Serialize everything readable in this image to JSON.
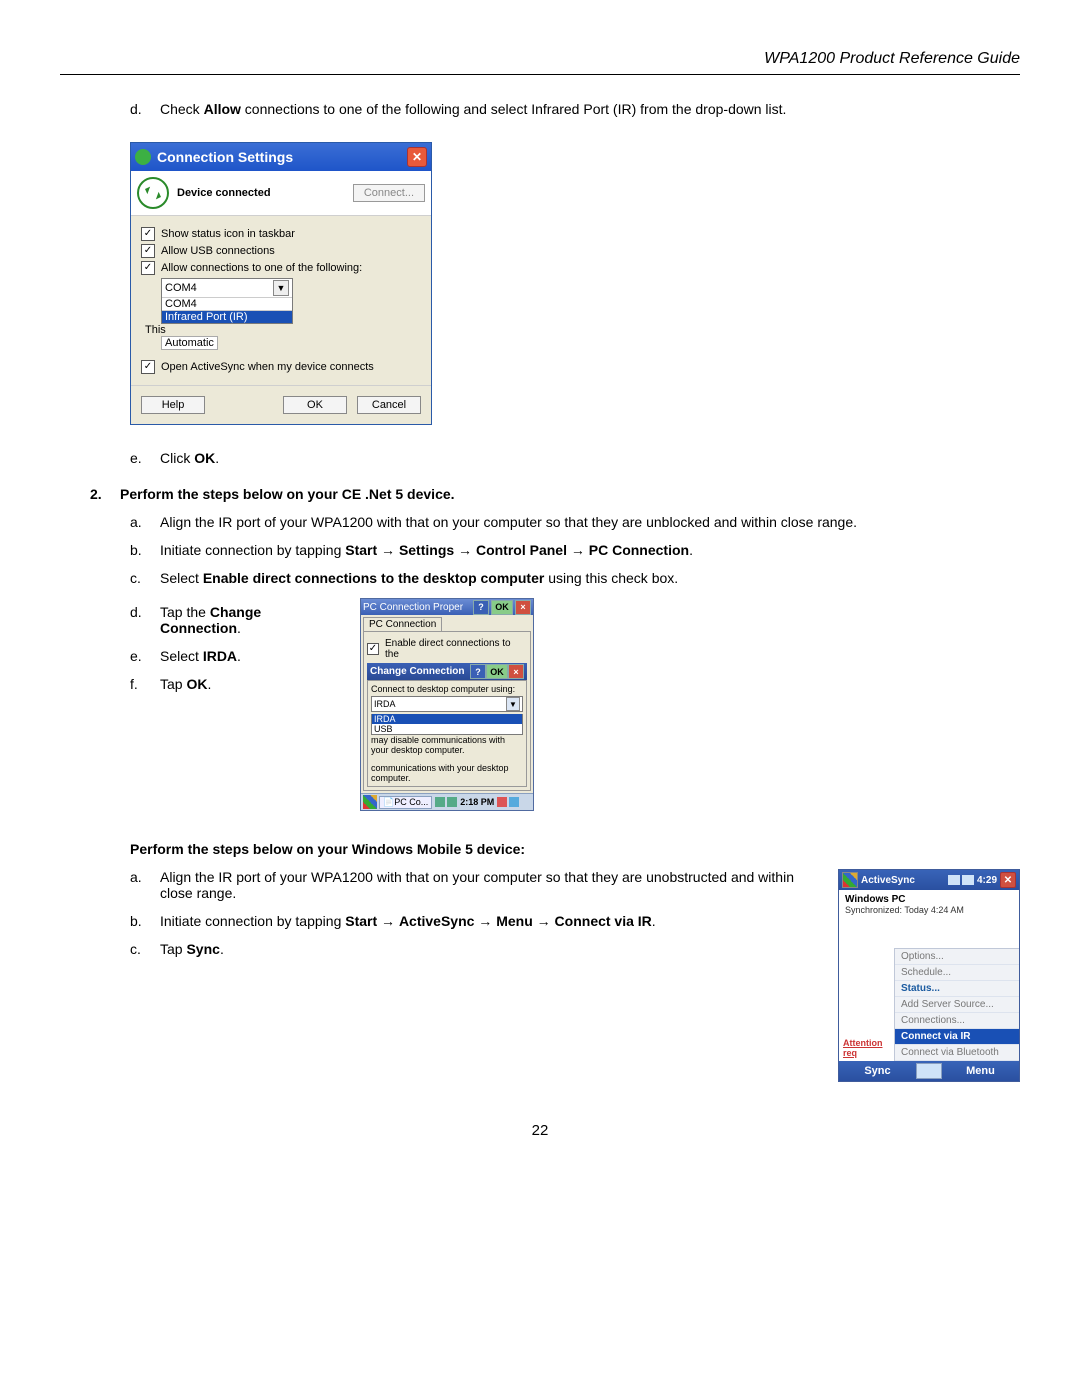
{
  "header": {
    "title": "WPA1200 Product Reference Guide"
  },
  "pageNumber": "22",
  "step_d": {
    "marker": "d.",
    "text_pre": "Check ",
    "text_bold": "Allow",
    "text_post": " connections to one of the following and select Infrared Port (IR) from the drop-down list."
  },
  "win1": {
    "title": "Connection Settings",
    "status": "Device connected",
    "connect_btn": "Connect...",
    "chk1": "Show status icon in taskbar",
    "chk2": "Allow USB connections",
    "chk3": "Allow connections to one of the following:",
    "combo_selected": "COM4",
    "combo_opt1": "COM4",
    "combo_opt2": "Infrared Port (IR)",
    "side_this": "This",
    "side_auto": "Automatic",
    "chk4": "Open ActiveSync when my device connects",
    "btn_help": "Help",
    "btn_ok": "OK",
    "btn_cancel": "Cancel"
  },
  "step_e": {
    "marker": "e.",
    "pre": "Click ",
    "bold": "OK",
    "post": "."
  },
  "step2": {
    "marker": "2.",
    "text": "Perform the steps below on your CE .Net 5 device."
  },
  "s2a": {
    "marker": "a.",
    "text": "Align the IR port of your WPA1200 with that on your computer so that they are unblocked and within close range."
  },
  "s2b": {
    "marker": "b.",
    "pre": "Initiate connection by tapping ",
    "b1": "Start",
    "arr": " → ",
    "b2": "Settings",
    "b3": "Control Panel",
    "b4": "PC Connection",
    "post": "."
  },
  "s2c": {
    "marker": "c.",
    "pre": "Select ",
    "bold": "Enable direct connections to the desktop computer",
    "post": " using this check box."
  },
  "s2d": {
    "marker": "d.",
    "pre": "Tap the ",
    "bold": "Change Connection",
    "post": "."
  },
  "s2e": {
    "marker": "e.",
    "pre": "Select ",
    "bold": "IRDA",
    "post": "."
  },
  "s2f": {
    "marker": "f.",
    "pre": "Tap ",
    "bold": "OK",
    "post": "."
  },
  "win2": {
    "topbar": "PC Connection Proper",
    "help": "?",
    "ok": "OK",
    "tab": "PC Connection",
    "chk": "Enable direct connections to the",
    "cc_title": "Change Connection",
    "cc_label": "Connect to desktop computer using:",
    "cc_sel": "IRDA",
    "cc_opt1": "IRDA",
    "cc_opt2": "USB",
    "cc_note1": "may disable communications with your desktop computer.",
    "cc_note2": "communications with your desktop computer.",
    "task_btn": "PC Co...",
    "task_time": "2:18 PM"
  },
  "wm5_heading": "Perform the steps below on your Windows Mobile 5 device:",
  "s3a": {
    "marker": "a.",
    "text": "Align the IR port of your WPA1200 with that on your computer so that they are unobstructed and within close range."
  },
  "s3b": {
    "marker": "b.",
    "pre": "Initiate connection by tapping ",
    "b1": "Start",
    "arr": " → ",
    "b2": "ActiveSync",
    "b3": "Menu",
    "b4": "Connect via IR",
    "post": "."
  },
  "s3c": {
    "marker": "c.",
    "pre": "Tap ",
    "bold": "Sync",
    "post": "."
  },
  "win3": {
    "title": "ActiveSync",
    "clock": "4:29",
    "wpc": "Windows PC",
    "syncline": "Synchronized: Today 4:24 AM",
    "mi_options": "Options...",
    "mi_schedule": "Schedule...",
    "mi_status": "Status...",
    "mi_addserver": "Add Server Source...",
    "attn": "Attention req",
    "mi_connections": "Connections...",
    "mi_connect_ir": "Connect via IR",
    "mi_connect_bt": "Connect via Bluetooth",
    "bot_sync": "Sync",
    "bot_menu": "Menu"
  }
}
